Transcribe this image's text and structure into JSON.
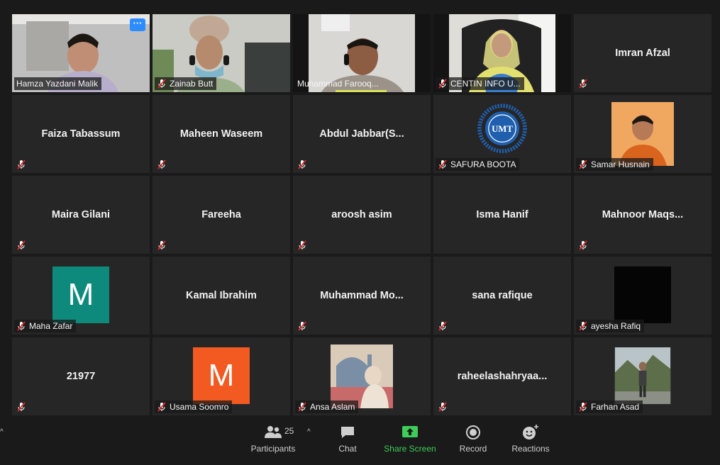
{
  "meeting": {
    "participant_count": "25",
    "toolbar": {
      "participants": "Participants",
      "chat": "Chat",
      "share_screen": "Share Screen",
      "record": "Record",
      "reactions": "Reactions"
    }
  },
  "tiles": [
    {
      "name": "Hamza Yazdani Malik",
      "more": "···"
    },
    {
      "name": "Zainab Butt"
    },
    {
      "name": "Muhammad Farooq..."
    },
    {
      "name": "CENTIN INFO U..."
    },
    {
      "name": "Imran Afzal"
    },
    {
      "name": "Faiza Tabassum"
    },
    {
      "name": "Maheen Waseem"
    },
    {
      "name": "Abdul  Jabbar(S..."
    },
    {
      "name": "SAFURA BOOTA",
      "logo_text": "UMT"
    },
    {
      "name": "Samar Husnain"
    },
    {
      "name": "Maira Gilani"
    },
    {
      "name": "Fareeha"
    },
    {
      "name": "aroosh asim"
    },
    {
      "name": "Isma Hanif"
    },
    {
      "name": "Mahnoor  Maqs..."
    },
    {
      "name": "Maha Zafar",
      "avatar_letter": "M",
      "avatar_color": "#0e8a7c"
    },
    {
      "name": "Kamal Ibrahim"
    },
    {
      "name": "Muhammad  Mo..."
    },
    {
      "name": "sana rafique"
    },
    {
      "name": "ayesha Rafiq"
    },
    {
      "name": "21977"
    },
    {
      "name": "Usama Soomro",
      "avatar_letter": "M",
      "avatar_color": "#f25a22"
    },
    {
      "name": "Ansa Aslam"
    },
    {
      "name": "raheelashahryaa..."
    },
    {
      "name": "Farhan Asad"
    }
  ]
}
